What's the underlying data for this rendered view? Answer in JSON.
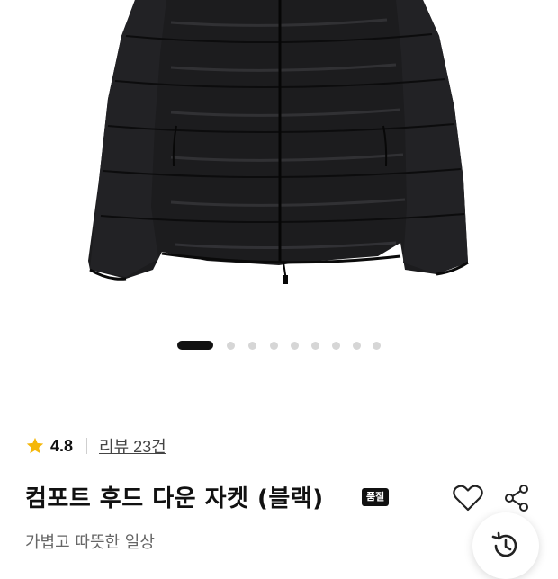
{
  "product_image": {
    "alt": "black puffer jacket"
  },
  "carousel": {
    "total": 9,
    "active_index": 0
  },
  "rating": {
    "score": "4.8",
    "star_color": "#F5B70A",
    "review_label": "리뷰 23건"
  },
  "product": {
    "title": "컴포트 후드 다운 자켓 (블랙)",
    "badge": "품절",
    "subtitle": "가볍고 따뜻한 일상"
  },
  "actions": {
    "wishlist_icon": "heart-icon",
    "share_icon": "share-icon",
    "recent_icon": "history-icon"
  }
}
